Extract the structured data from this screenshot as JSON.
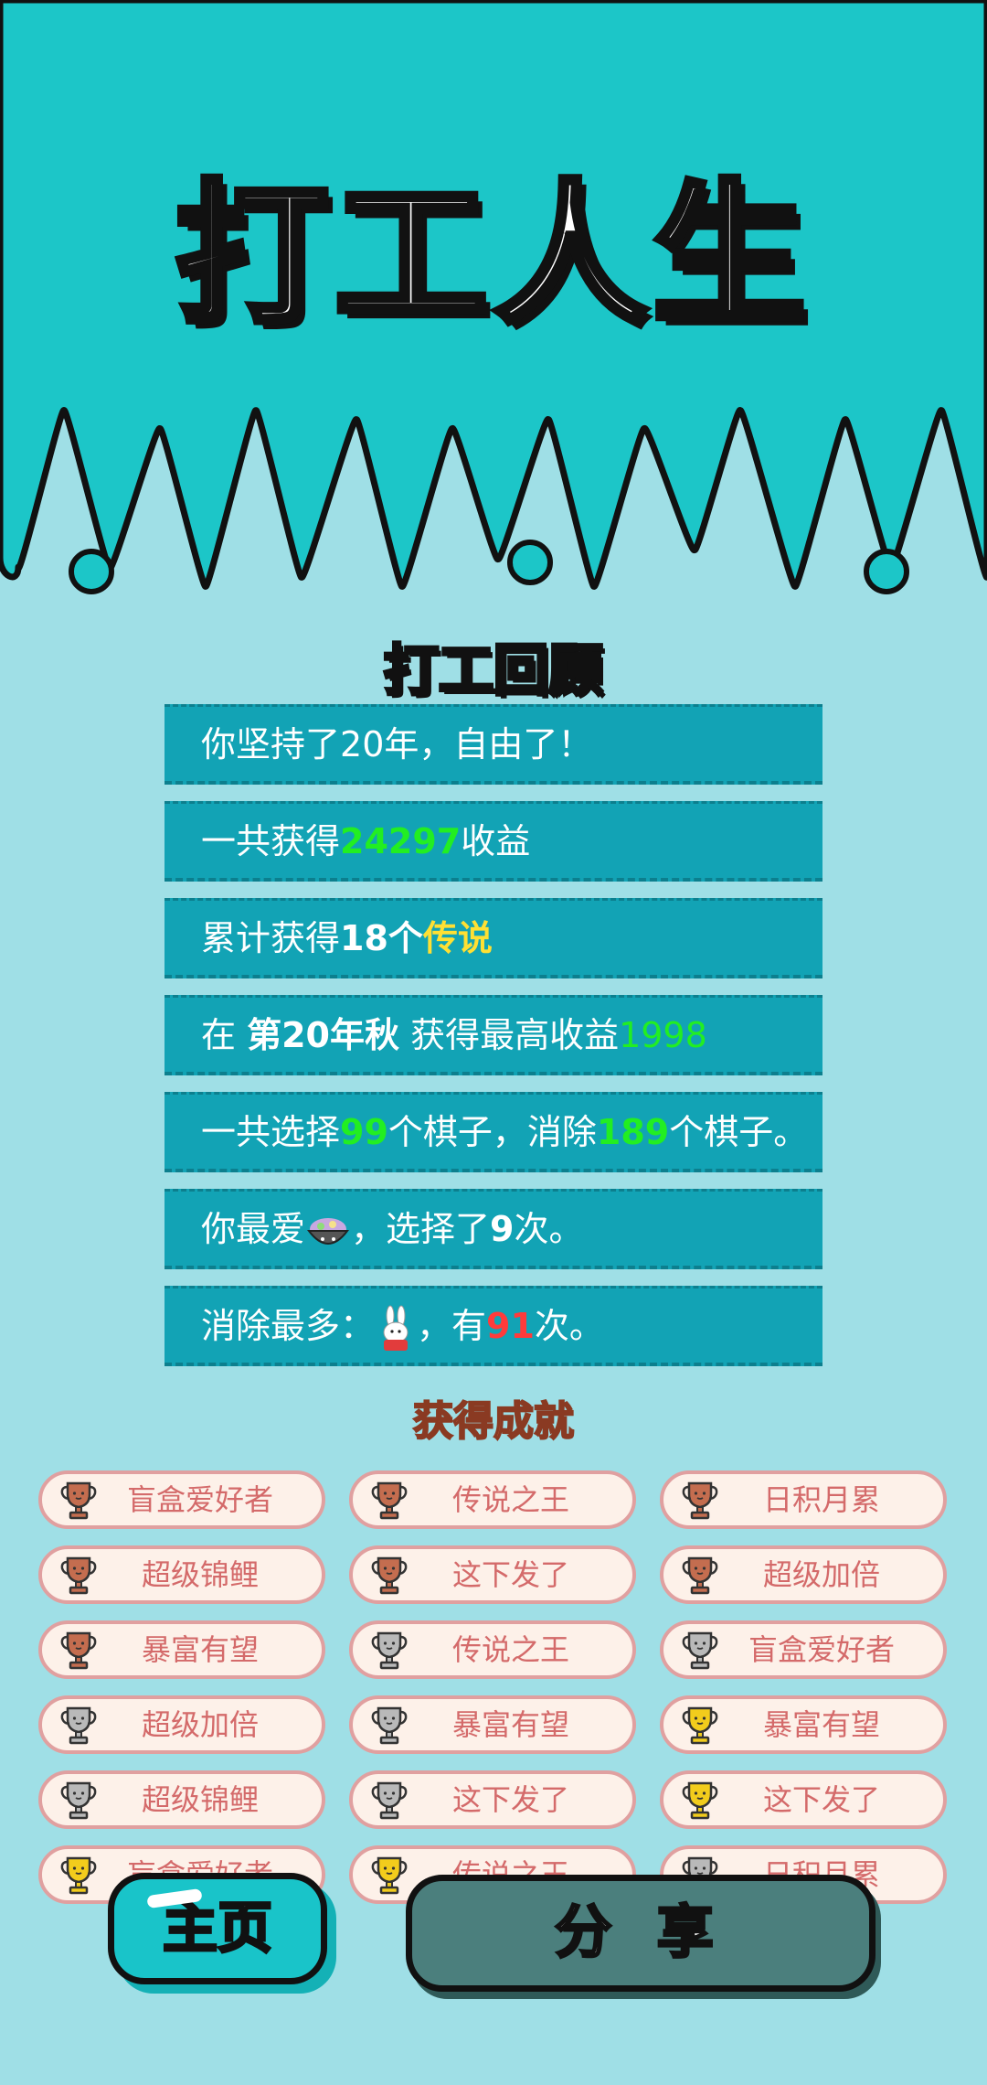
{
  "game_title": "打工人生",
  "review": {
    "title": "打工回顾",
    "lines": [
      {
        "prefix": "你坚持了",
        "value": "20年",
        "suffix": "，自由了！"
      },
      {
        "prefix": "一共获得",
        "value": "24297",
        "suffix": "收益"
      },
      {
        "prefix": "累计获得",
        "value": "18个",
        "suffix": "传说"
      },
      {
        "prefix": "在 ",
        "value": "第20年秋",
        "middle": " 获得最高收益",
        "suffix": "1998"
      },
      {
        "prefix": "一共选择",
        "value": "99",
        "middle": "个棋子，消除",
        "value2": "189",
        "suffix": "个棋子。"
      },
      {
        "prefix": "你最爱",
        "middle": "，选择了",
        "value": "9",
        "suffix": "次。",
        "icon": "rice-bowl-icon"
      },
      {
        "prefix": "消除最多：",
        "middle": "，有",
        "value": "91",
        "suffix": "次。",
        "icon": "rabbit-icon"
      }
    ]
  },
  "achievements": {
    "title": "获得成就",
    "items": [
      {
        "label": "盲盒爱好者",
        "tier": "bronze"
      },
      {
        "label": "传说之王",
        "tier": "bronze"
      },
      {
        "label": "日积月累",
        "tier": "bronze"
      },
      {
        "label": "超级锦鲤",
        "tier": "bronze"
      },
      {
        "label": "这下发了",
        "tier": "bronze"
      },
      {
        "label": "超级加倍",
        "tier": "bronze"
      },
      {
        "label": "暴富有望",
        "tier": "bronze"
      },
      {
        "label": "传说之王",
        "tier": "silver"
      },
      {
        "label": "盲盒爱好者",
        "tier": "silver"
      },
      {
        "label": "超级加倍",
        "tier": "silver"
      },
      {
        "label": "暴富有望",
        "tier": "silver"
      },
      {
        "label": "暴富有望",
        "tier": "gold"
      },
      {
        "label": "超级锦鲤",
        "tier": "silver"
      },
      {
        "label": "这下发了",
        "tier": "silver"
      },
      {
        "label": "这下发了",
        "tier": "gold"
      },
      {
        "label": "盲盒爱好者",
        "tier": "gold"
      },
      {
        "label": "传说之王",
        "tier": "gold"
      },
      {
        "label": "日积月累",
        "tier": "silver"
      }
    ]
  },
  "buttons": {
    "home": "主页",
    "share": "分 享"
  },
  "colors": {
    "header_bg": "#1cc6c8",
    "body_bg": "#9fdfe6",
    "row_bg": "#12a3b5",
    "highlight_green": "#22ee22",
    "highlight_yellow": "#ffe033",
    "highlight_red": "#ff3b3b",
    "badge_bg": "#fdf1e9",
    "badge_text": "#d46a6a",
    "share_button": "#4b7f7d"
  }
}
